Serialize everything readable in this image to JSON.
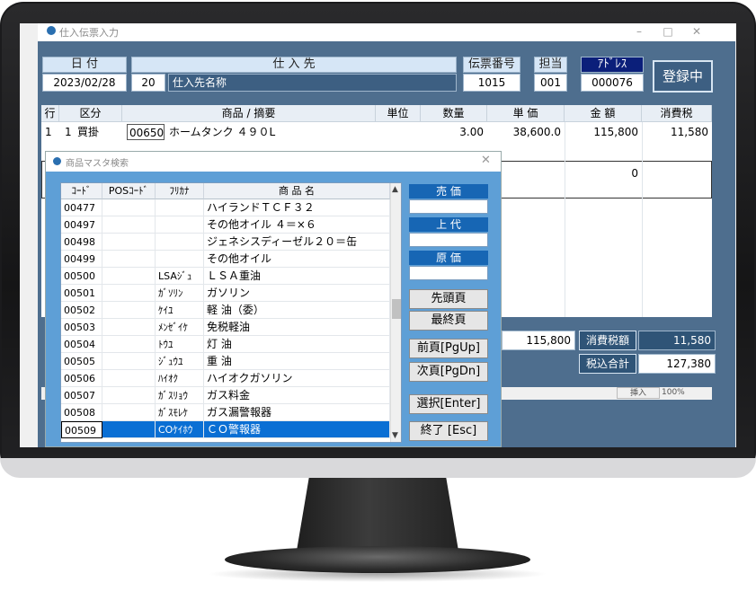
{
  "window": {
    "title": "仕入伝票入力",
    "controls": [
      "–",
      "□",
      "✕"
    ]
  },
  "header": {
    "date_label": "日 付",
    "date_value": "2023/02/28",
    "supplier_label": "仕 入 先",
    "supplier_code": "20",
    "supplier_name": "仕入先名称",
    "slip_label": "伝票番号",
    "slip_value": "1015",
    "staff_label": "担当",
    "staff_value": "001",
    "address_label": "ｱﾄﾞﾚｽ",
    "address_value": "000076",
    "register_button": "登録中"
  },
  "grid": {
    "columns": [
      "行",
      "区分",
      "商品 / 摘要",
      "単位",
      "数量",
      "単 価",
      "金 額",
      "消費税"
    ],
    "row1": {
      "line": "1",
      "kubun_code": "1",
      "kubun_name": "買掛",
      "product_code": "00650",
      "product_name": "ホームタンク ４９０L",
      "unit": "",
      "qty": "3.00",
      "price": "38,600.0",
      "amount": "115,800",
      "tax": "11,580"
    },
    "row2_amount": "0"
  },
  "totals": {
    "subtotal": "115,800",
    "tax_label": "消費税額",
    "tax_value": "11,580",
    "total_label": "税込合計",
    "total_value": "127,380"
  },
  "status": {
    "mode": "挿入",
    "zoom": "100%"
  },
  "dialog": {
    "title": "商品マスタ検索",
    "close": "✕",
    "columns": [
      "ｺｰﾄﾞ",
      "POSｺｰﾄﾞ",
      "ﾌﾘｶﾅ",
      "商 品 名"
    ],
    "rows": [
      {
        "code": "00477",
        "pos": "",
        "kana": "",
        "name": "ハイランドＴＣＦ３２"
      },
      {
        "code": "00497",
        "pos": "",
        "kana": "",
        "name": "その他オイル ４＝×６"
      },
      {
        "code": "00498",
        "pos": "",
        "kana": "",
        "name": "ジェネシスディーゼル２０＝缶"
      },
      {
        "code": "00499",
        "pos": "",
        "kana": "",
        "name": "その他オイル"
      },
      {
        "code": "00500",
        "pos": "",
        "kana": "LSAｼﾞｭ",
        "name": "ＬＳＡ重油"
      },
      {
        "code": "00501",
        "pos": "",
        "kana": "ｶﾞｿﾘﾝ",
        "name": "ガソリン"
      },
      {
        "code": "00502",
        "pos": "",
        "kana": "ｹｲﾕ",
        "name": "軽 油（委）"
      },
      {
        "code": "00503",
        "pos": "",
        "kana": "ﾒﾝｾﾞｲｹ",
        "name": "免税軽油"
      },
      {
        "code": "00504",
        "pos": "",
        "kana": "ﾄｳﾕ",
        "name": "灯 油"
      },
      {
        "code": "00505",
        "pos": "",
        "kana": "ｼﾞｭｳﾕ",
        "name": "重 油"
      },
      {
        "code": "00506",
        "pos": "",
        "kana": "ﾊｲｵｸ",
        "name": "ハイオクガソリン"
      },
      {
        "code": "00507",
        "pos": "",
        "kana": "ｶﾞｽﾘｮｳ",
        "name": "ガス料金"
      },
      {
        "code": "00508",
        "pos": "",
        "kana": "ｶﾞｽﾓﾚｹ",
        "name": "ガス漏警報器"
      },
      {
        "code": "00509",
        "pos": "",
        "kana": "COｹｲﾎｳ",
        "name": "ＣＯ警報器"
      }
    ],
    "selected_index": 13,
    "price_labels": [
      "売 価",
      "上 代",
      "原 価"
    ],
    "buttons": [
      "先頭頁",
      "最終頁",
      "前頁[PgUp]",
      "次頁[PgDn]",
      "選択[Enter]",
      "終了 [Esc]"
    ]
  }
}
